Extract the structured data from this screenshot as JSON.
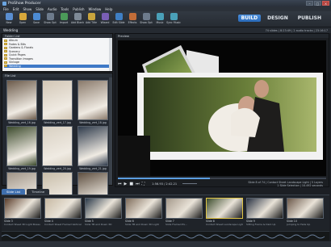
{
  "window": {
    "title": "ProShow Producer"
  },
  "menu": [
    "File",
    "Edit",
    "Show",
    "Slide",
    "Audio",
    "Tools",
    "Publish",
    "Window",
    "Help"
  ],
  "toolbar": {
    "tools": [
      {
        "label": "New",
        "icon": "new-icon",
        "color": "#5a8ed0"
      },
      {
        "label": "Open",
        "icon": "open-icon",
        "color": "#d8a83b"
      },
      {
        "label": "Save",
        "icon": "save-icon",
        "color": "#4c8bd3"
      },
      {
        "label": "Show Opt",
        "icon": "show-options-icon",
        "color": "#6d7b8c"
      },
      {
        "label": "Import",
        "icon": "import-icon",
        "color": "#4b9a59"
      },
      {
        "label": "Add Blank",
        "icon": "add-blank-icon",
        "color": "#7e8a97"
      },
      {
        "label": "Add Title",
        "icon": "add-title-icon",
        "color": "#c9a53d"
      },
      {
        "label": "Wizard",
        "icon": "wizard-icon",
        "color": "#7a5fb5"
      },
      {
        "label": "Edit Slide",
        "icon": "edit-slide-icon",
        "color": "#3f7fc4"
      },
      {
        "label": "Effects",
        "icon": "effects-icon",
        "color": "#c26d38"
      },
      {
        "label": "Show Opt",
        "icon": "options-icon",
        "color": "#6d7b8c"
      },
      {
        "label": "Music",
        "icon": "music-icon",
        "color": "#4aa0b8"
      },
      {
        "label": "Sync Music",
        "icon": "sync-music-icon",
        "color": "#4aa0b8"
      }
    ],
    "modes": [
      "BUILD",
      "DESIGN",
      "PUBLISH"
    ],
    "active_mode": "BUILD"
  },
  "crumb": {
    "title": "Wedding",
    "info": "74 slides | 8:23:49 | 2 audio tracks | 23:16:17"
  },
  "folder_panel": {
    "title": "Folder List",
    "items": [
      "Album",
      "Fades & Bits",
      "Gardens & Florals",
      "Scenery",
      "Quick Pages",
      "Transition Images",
      "Vintage",
      "Wedding"
    ],
    "selected": 7
  },
  "file_panel": {
    "title": "File List",
    "files": [
      {
        "name": "Wedding_vert_16.jpg",
        "tone": "#6b5a4a"
      },
      {
        "name": "Wedding_vert_17.jpg",
        "tone": "#d2c6b5"
      },
      {
        "name": "Wedding_vert_18.jpg",
        "tone": "#8a7a6b"
      },
      {
        "name": "Wedding_vert_19.jpg",
        "tone": "#3b4a2c"
      },
      {
        "name": "Wedding_vert_20.jpg",
        "tone": "#d8d0c2"
      },
      {
        "name": "Wedding_vert_21.jpg",
        "tone": "#2f3b4c"
      },
      {
        "name": "Wedding_vert_22.jpg",
        "tone": "#a09588"
      },
      {
        "name": "Wedding_vert_23.jpg",
        "tone": "#c8bda9"
      },
      {
        "name": "Wedding_vert_24.jpg",
        "tone": "#5e4f40"
      }
    ]
  },
  "preview": {
    "title": "Preview",
    "time": "1:56.93 / 2:42.21",
    "progress": 0.44,
    "slide_info_1": "Slide 8 of 74 | Contact Sheet Landscape Light | 5 Layers",
    "slide_info_2": "1 Slide Selection | 10.492 seconds"
  },
  "tabs": [
    "Slide List",
    "Timeline"
  ],
  "slides": [
    {
      "num": "Slide 3",
      "name": "Contact Sheet 3D Light Boxes",
      "tone": "#5a3d2b"
    },
    {
      "num": "Slide 4",
      "name": "Contact Sheet Framed Vertical",
      "tone": "#c7b9a3"
    },
    {
      "num": "Slide 5",
      "name": "Slide TB and Down 3D",
      "tone": "#2b3a4a"
    },
    {
      "num": "Slide 6",
      "name": "Slide TB and Down 3D Light",
      "tone": "#7f6d5c"
    },
    {
      "num": "Slide 7",
      "name": "Slide Framed Ex...",
      "tone": "#a5998b"
    },
    {
      "num": "Slide 8",
      "name": "Contact Sheet Landscape Light",
      "tone": "#3b4b2b"
    },
    {
      "num": "Slide 9",
      "name": "Sitting Frame & Dark Up",
      "tone": "#2b3444"
    },
    {
      "num": "Slide 10",
      "name": "Jumping to Fade Up",
      "tone": "#6b584a"
    }
  ],
  "selected_slide": 5
}
